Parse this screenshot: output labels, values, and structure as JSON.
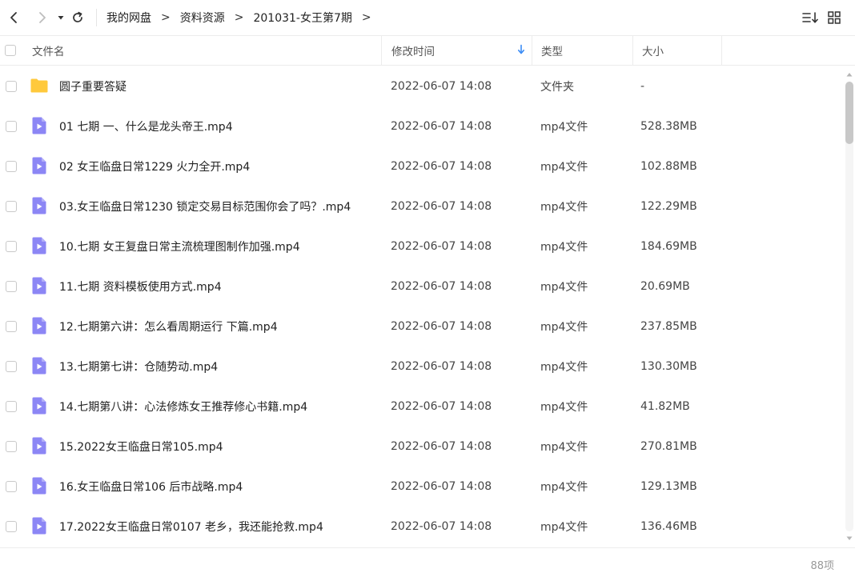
{
  "nav": {
    "breadcrumb": [
      "我的网盘",
      "资料资源",
      "201031-女王第7期"
    ],
    "separator": ">"
  },
  "columns": {
    "name": "文件名",
    "time": "修改时间",
    "type": "类型",
    "size": "大小"
  },
  "colors": {
    "folder": "#FFC93C",
    "video": "#8C86F5",
    "sort_arrow": "#3B8CF5",
    "scroll_thumb": "#C8C8C8"
  },
  "sort": {
    "column": "time",
    "direction": "desc"
  },
  "rows": [
    {
      "icon": "folder-icon",
      "name": "圆子重要答疑",
      "time": "2022-06-07 14:08",
      "type": "文件夹",
      "size": "-"
    },
    {
      "icon": "video-file-icon",
      "name": "01 七期 一、什么是龙头帝王.mp4",
      "time": "2022-06-07 14:08",
      "type": "mp4文件",
      "size": "528.38MB"
    },
    {
      "icon": "video-file-icon",
      "name": "02 女王临盘日常1229 火力全开.mp4",
      "time": "2022-06-07 14:08",
      "type": "mp4文件",
      "size": "102.88MB"
    },
    {
      "icon": "video-file-icon",
      "name": "03.女王临盘日常1230 锁定交易目标范围你会了吗？.mp4",
      "time": "2022-06-07 14:08",
      "type": "mp4文件",
      "size": "122.29MB"
    },
    {
      "icon": "video-file-icon",
      "name": "10.七期 女王复盘日常主流梳理图制作加强.mp4",
      "time": "2022-06-07 14:08",
      "type": "mp4文件",
      "size": "184.69MB"
    },
    {
      "icon": "video-file-icon",
      "name": "11.七期 资料模板使用方式.mp4",
      "time": "2022-06-07 14:08",
      "type": "mp4文件",
      "size": "20.69MB"
    },
    {
      "icon": "video-file-icon",
      "name": "12.七期第六讲：怎么看周期运行 下篇.mp4",
      "time": "2022-06-07 14:08",
      "type": "mp4文件",
      "size": "237.85MB"
    },
    {
      "icon": "video-file-icon",
      "name": "13.七期第七讲：仓随势动.mp4",
      "time": "2022-06-07 14:08",
      "type": "mp4文件",
      "size": "130.30MB"
    },
    {
      "icon": "video-file-icon",
      "name": "14.七期第八讲：心法修炼女王推荐修心书籍.mp4",
      "time": "2022-06-07 14:08",
      "type": "mp4文件",
      "size": "41.82MB"
    },
    {
      "icon": "video-file-icon",
      "name": "15.2022女王临盘日常105.mp4",
      "time": "2022-06-07 14:08",
      "type": "mp4文件",
      "size": "270.81MB"
    },
    {
      "icon": "video-file-icon",
      "name": "16.女王临盘日常106 后市战略.mp4",
      "time": "2022-06-07 14:08",
      "type": "mp4文件",
      "size": "129.13MB"
    },
    {
      "icon": "video-file-icon",
      "name": "17.2022女王临盘日常0107 老乡，我还能抢救.mp4",
      "time": "2022-06-07 14:08",
      "type": "mp4文件",
      "size": "136.46MB"
    }
  ],
  "footer": {
    "count_label": "88项"
  }
}
